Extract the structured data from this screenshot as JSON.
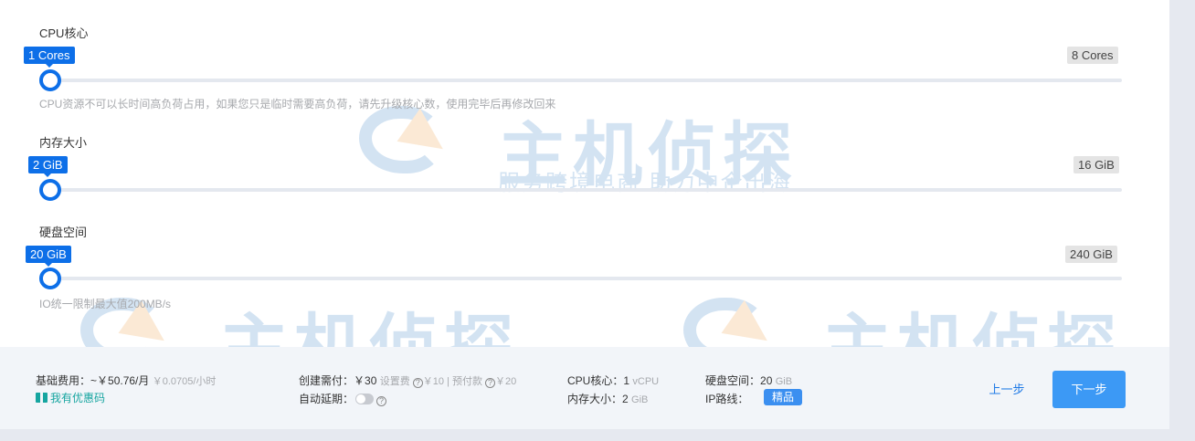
{
  "cpu": {
    "label": "CPU核心",
    "min_label": "1 Cores",
    "max_label": "8 Cores",
    "hint": "CPU资源不可以长时间高负荷占用，如果您只是临时需要高负荷，请先升级核心数，使用完毕后再修改回来"
  },
  "memory": {
    "label": "内存大小",
    "min_label": "2 GiB",
    "max_label": "16 GiB"
  },
  "disk": {
    "label": "硬盘空间",
    "min_label": "20 GiB",
    "max_label": "240 GiB",
    "hint": "IO统一限制最大值200MB/s"
  },
  "footer": {
    "base_fee_label": "基础费用：",
    "base_fee_value": "~￥50.76/月",
    "base_fee_hourly": "￥0.0705/小时",
    "coupon_label": "我有优惠码",
    "create_fee_label": "创建需付：",
    "create_fee_value": "￥30",
    "setup_fee": "设置费",
    "setup_fee_value": "￥10",
    "prepay_label": "预付款",
    "prepay_value": "￥20",
    "auto_renew_label": "自动延期：",
    "cpu_summary_label": "CPU核心：",
    "cpu_summary_value": "1",
    "cpu_summary_unit": "vCPU",
    "mem_summary_label": "内存大小：",
    "mem_summary_value": "2",
    "mem_summary_unit": "GiB",
    "disk_summary_label": "硬盘空间：",
    "disk_summary_value": "20",
    "disk_summary_unit": "GiB",
    "ip_line_label": "IP路线：",
    "ip_line_value": "精品",
    "prev_button": "上一步",
    "next_button": "下一步"
  },
  "watermark": {
    "title": "主机侦探",
    "subtitle": "服务跨境电商 助力中企出海"
  },
  "colors": {
    "accent": "#0d6fe8",
    "button": "#3c99f5",
    "coupon": "#16a5a0"
  }
}
